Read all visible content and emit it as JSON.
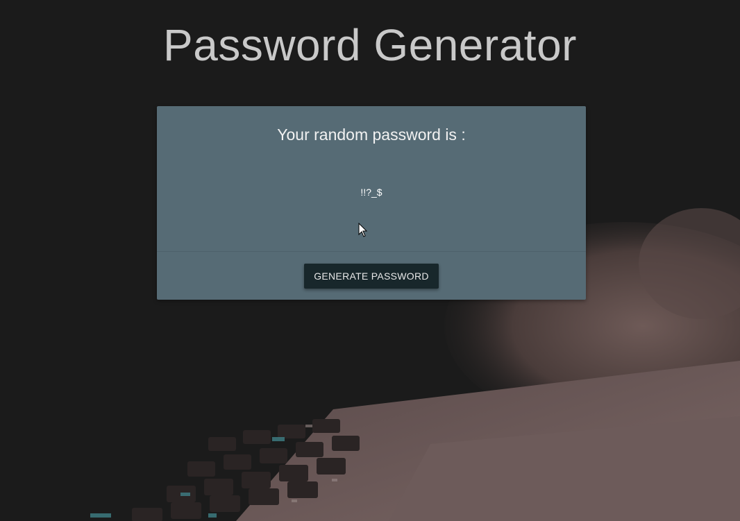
{
  "header": {
    "title": "Password Generator"
  },
  "card": {
    "heading": "Your random password is :",
    "password": "!!?_$",
    "generate_label": "GENERATE PASSWORD"
  },
  "colors": {
    "background": "#1b1b1b",
    "card": "#566b75",
    "button": "#18272b",
    "title": "#c9c9c9"
  },
  "icons": {
    "cursor": "mouse-pointer-icon"
  }
}
